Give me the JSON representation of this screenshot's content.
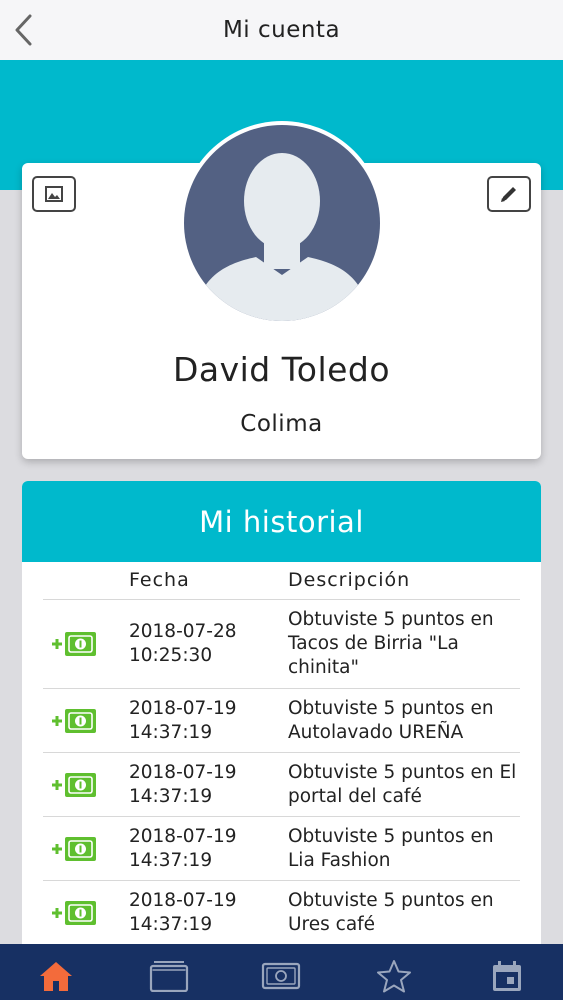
{
  "header": {
    "title": "Mi cuenta",
    "back_icon": "chevron-left-icon"
  },
  "profile": {
    "name": "David Toledo",
    "city": "Colima",
    "photo_icon": "image-icon",
    "edit_icon": "pencil-icon",
    "avatar_icon": "person-silhouette-icon"
  },
  "history": {
    "title": "Mi historial",
    "columns": [
      "",
      "Fecha",
      "Descripción"
    ],
    "rows": [
      {
        "icon": "plus-money-icon",
        "date": "2018-07-28",
        "time": "10:25:30",
        "description": "Obtuviste 5 puntos en Tacos de Birria \"La chinita\""
      },
      {
        "icon": "plus-money-icon",
        "date": "2018-07-19",
        "time": "14:37:19",
        "description": "Obtuviste 5 puntos en Autolavado UREÑA"
      },
      {
        "icon": "plus-money-icon",
        "date": "2018-07-19",
        "time": "14:37:19",
        "description": "Obtuviste 5 puntos en El portal del café"
      },
      {
        "icon": "plus-money-icon",
        "date": "2018-07-19",
        "time": "14:37:19",
        "description": "Obtuviste 5 puntos en Lia Fashion"
      },
      {
        "icon": "plus-money-icon",
        "date": "2018-07-19",
        "time": "14:37:19",
        "description": "Obtuviste 5 puntos en Ures café"
      }
    ]
  },
  "nav": {
    "items": [
      {
        "icon": "home-icon",
        "active": true
      },
      {
        "icon": "wallet-icon",
        "active": false
      },
      {
        "icon": "banknote-icon",
        "active": false
      },
      {
        "icon": "star-icon",
        "active": false
      },
      {
        "icon": "calendar-icon",
        "active": false
      }
    ]
  },
  "colors": {
    "accent": "#00b9cc",
    "nav_background": "#173063",
    "nav_active": "#f36b3b",
    "money_icon": "#5fbf2f",
    "avatar_background": "#536183"
  }
}
